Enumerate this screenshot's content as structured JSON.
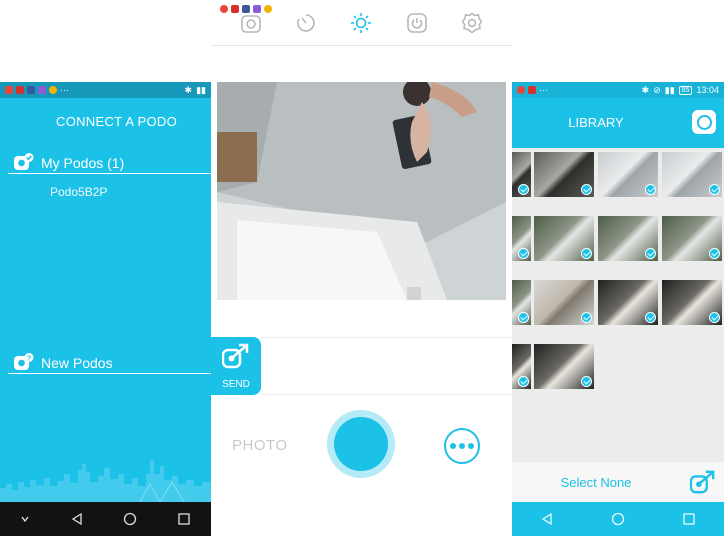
{
  "colors": {
    "accent": "#1cc1e8",
    "accent_dark": "#1598ba",
    "nav_dark": "#101214"
  },
  "connect_screen": {
    "title": "CONNECT A PODO",
    "my_podos": {
      "label": "My Podos  (1)"
    },
    "podo_items": [
      "Podo5B2P"
    ],
    "new_podos": {
      "label": "New Podos"
    },
    "status_icons": [
      "chrome-icon",
      "youtube-icon",
      "facebook-icon",
      "gallery-icon",
      "more-dots-icon",
      "bluetooth-icon",
      "signal-icon"
    ],
    "nav_icons": [
      "chevron-down-icon",
      "back-icon",
      "home-icon",
      "recents-icon"
    ]
  },
  "camera_screen": {
    "toolbar_icons": [
      "camera-icon",
      "timer-icon",
      "brightness-icon",
      "power-icon",
      "settings-icon"
    ],
    "send_label": "SEND",
    "mode_label": "PHOTO",
    "more_icon": "more-dots-icon"
  },
  "library_screen": {
    "status_time": "13:04",
    "battery": "85",
    "title": "LIBRARY",
    "select_label": "Select None",
    "thumbnails": [
      {
        "selected": true,
        "tone": "dark-room"
      },
      {
        "selected": true,
        "tone": "dark-room"
      },
      {
        "selected": true,
        "tone": "ceiling"
      },
      {
        "selected": true,
        "tone": "ceiling"
      },
      {
        "selected": true,
        "tone": "window"
      },
      {
        "selected": true,
        "tone": "window"
      },
      {
        "selected": true,
        "tone": "window"
      },
      {
        "selected": true,
        "tone": "window"
      },
      {
        "selected": true,
        "tone": "window"
      },
      {
        "selected": true,
        "tone": "person"
      },
      {
        "selected": true,
        "tone": "dark-window"
      },
      {
        "selected": true,
        "tone": "dark-window"
      },
      {
        "selected": true,
        "tone": "dark-window"
      },
      {
        "selected": true,
        "tone": "dark-window"
      }
    ]
  }
}
